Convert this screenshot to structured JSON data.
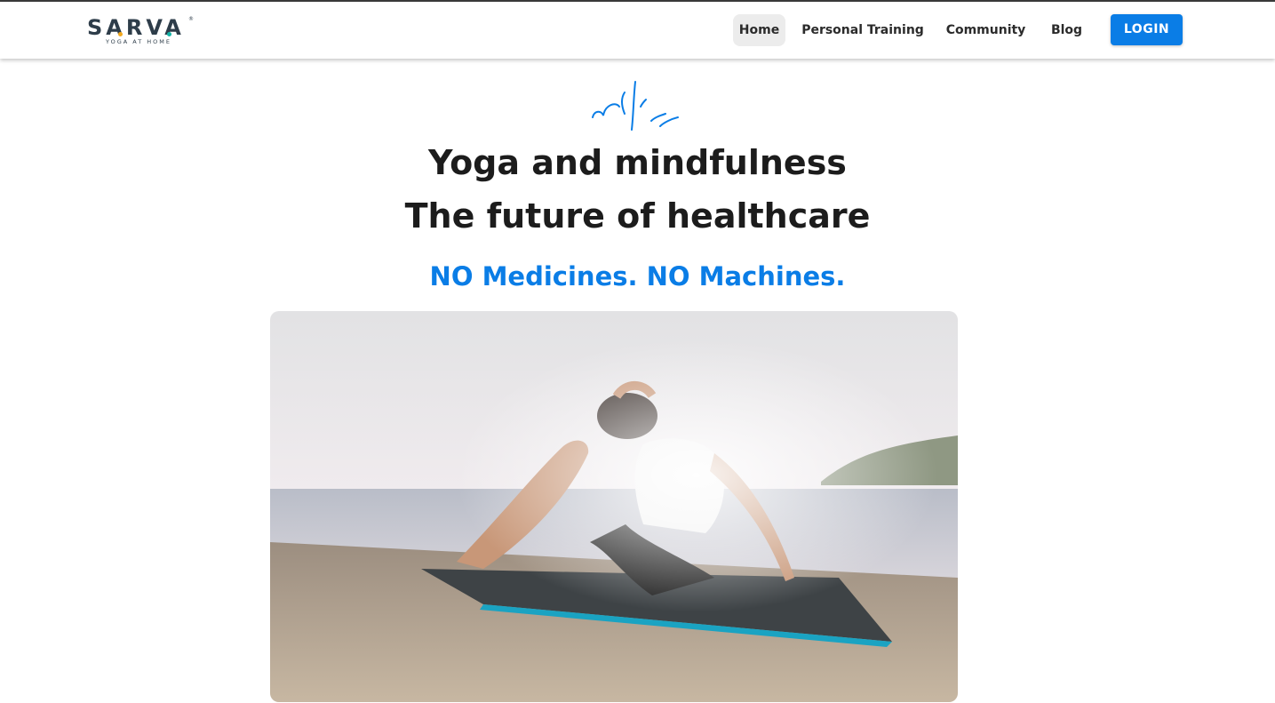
{
  "brand": {
    "name": "SARVA",
    "registered": "®",
    "subtitle": "YOGA AT HOME",
    "colors": {
      "text": "#2e3d4a",
      "accent_teal": "#12b3a6",
      "accent_orange": "#f2a81d",
      "accent_pink": "#e0457b"
    }
  },
  "nav": {
    "items": [
      {
        "label": "Home",
        "active": true
      },
      {
        "label": "Personal Training",
        "active": false
      },
      {
        "label": "Community",
        "active": false
      },
      {
        "label": "Blog",
        "active": false
      }
    ],
    "login_label": "LOGIN"
  },
  "hero": {
    "headline_line1": "Yoga and mindfulness",
    "headline_line2": "The future of healthcare",
    "tagline": "NO Medicines. NO Machines.",
    "accent_color": "#0a7de6",
    "image_icon": "yoga-pose-beach-photo"
  }
}
